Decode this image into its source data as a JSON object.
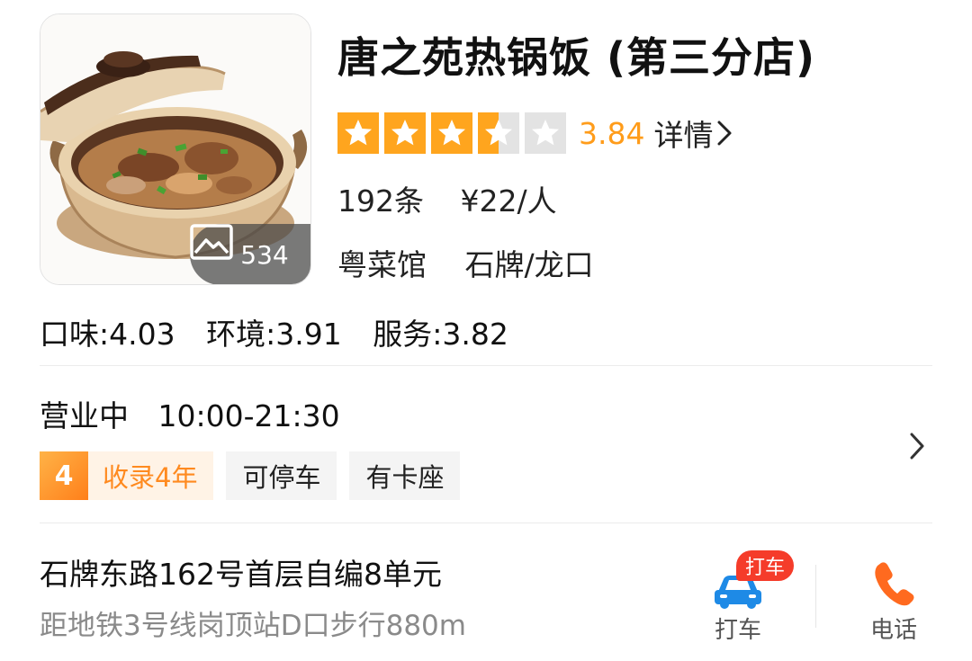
{
  "shop": {
    "name": "唐之苑热锅饭 (第三分店)",
    "photo_count": "534",
    "rating": 3.5,
    "rating_max": 5,
    "score": "3.84",
    "detail_label": "详情",
    "reviews": "192条",
    "price": "¥22/人",
    "category": "粤菜馆",
    "area": "石牌/龙口"
  },
  "sub_scores": {
    "taste": "口味:4.03",
    "environment": "环境:3.91",
    "service": "服务:3.82"
  },
  "hours": {
    "status": "营业中",
    "time": "10:00-21:30"
  },
  "tags": {
    "years_badge": "4",
    "years_label": "收录4年",
    "parking": "可停车",
    "booth": "有卡座"
  },
  "location": {
    "address": "石牌东路162号首层自编8单元",
    "distance": "距地铁3号线岗顶站D口步行880m"
  },
  "actions": {
    "taxi_badge": "打车",
    "taxi_label": "打车",
    "call_label": "电话"
  },
  "colors": {
    "star_filled": "#ffa51e",
    "star_empty": "#e3e3e3",
    "score": "#ff9c1a",
    "tag_years_bg": "#fff3e6",
    "taxi_blue": "#1e8ae6",
    "phone_orange": "#ff6a1f",
    "badge_red": "#f53c2a"
  },
  "icons": {
    "gallery": "image-icon",
    "detail": "chevron-right-icon",
    "taxi": "car-icon",
    "call": "phone-icon"
  }
}
